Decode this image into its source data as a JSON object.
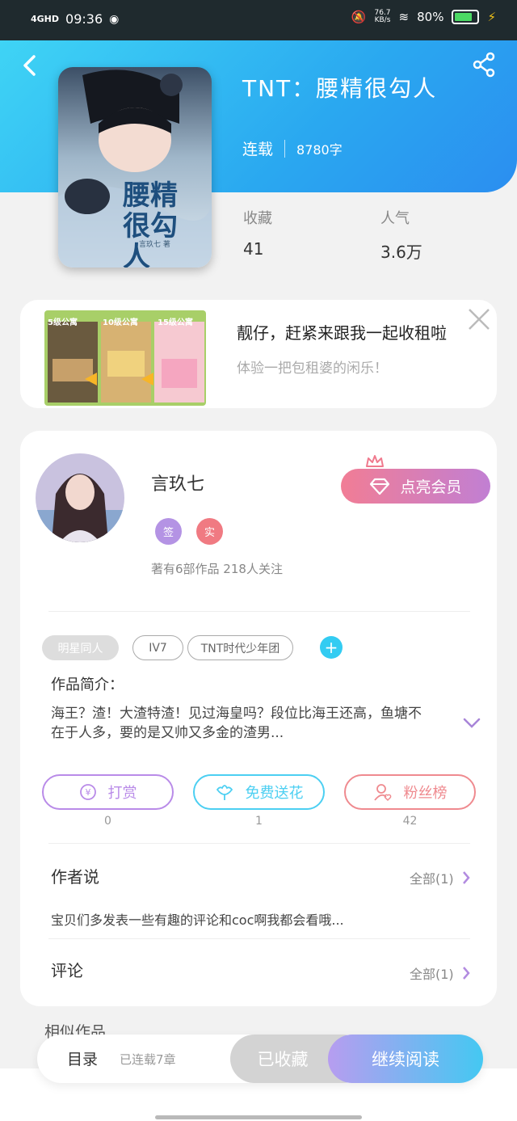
{
  "status": {
    "network": "4GHD",
    "time": "09:36",
    "speed_value": "76.7",
    "speed_unit": "KB/s",
    "battery": "80%"
  },
  "book": {
    "title": "TNT：腰精很勾人",
    "status": "连载",
    "words": "8780字",
    "cover_title": "腰精很勾人",
    "cover_author": "言玖七 著"
  },
  "stats": [
    {
      "label": "收藏",
      "value": "41"
    },
    {
      "label": "人气",
      "value": "3.6万"
    }
  ],
  "ad": {
    "img_labels": [
      "5级公寓",
      "10级公寓",
      "15级公寓"
    ],
    "title": "靓仔，赶紧来跟我一起收租啦",
    "subtitle": "体验一把包租婆的闲乐！"
  },
  "author": {
    "name": "言玖七",
    "badges": [
      "签",
      "实"
    ],
    "stats": "著有6部作品 218人关注",
    "vip_label": "点亮会员"
  },
  "tags": [
    "明星同人",
    "IV7",
    "TNT时代少年团"
  ],
  "intro": {
    "heading": "作品简介：",
    "text": "海王？渣！大渣特渣！见过海皇吗？段位比海王还高，鱼塘不在于人多，要的是又帅又多金的渣男..."
  },
  "actions": [
    {
      "label": "打赏",
      "count": "0",
      "color": "#b98be8"
    },
    {
      "label": "免费送花",
      "count": "1",
      "color": "#4ccff2"
    },
    {
      "label": "粉丝榜",
      "count": "42",
      "color": "#ef8a8f"
    }
  ],
  "author_says": {
    "heading": "作者说",
    "all": "全部(1)",
    "text": "宝贝们多发表一些有趣的评论和coc啊我都会看哦..."
  },
  "comments": {
    "heading": "评论",
    "all": "全部(1)"
  },
  "similar": {
    "heading": "相似作品"
  },
  "bottom": {
    "toc": "目录",
    "toc_sub": "已连载7章",
    "fav": "已收藏",
    "read": "继续阅读"
  }
}
